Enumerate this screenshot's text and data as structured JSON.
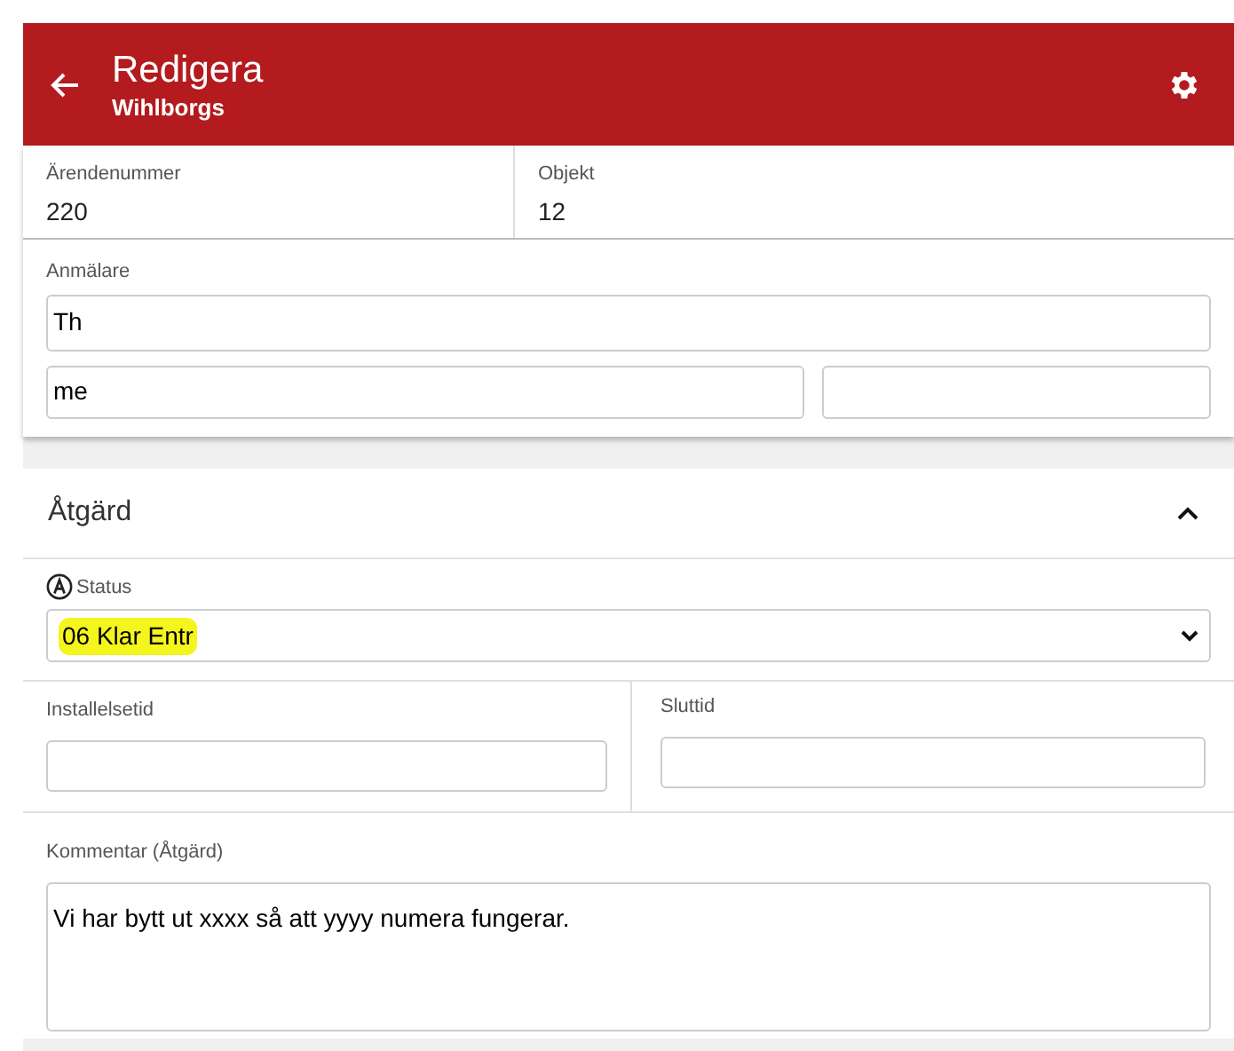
{
  "header": {
    "title": "Redigera",
    "subtitle": "Wihlborgs"
  },
  "info": [
    {
      "label": "Ärendenummer",
      "value": "220"
    },
    {
      "label": "Objekt",
      "value": "12"
    }
  ],
  "reporter": {
    "label": "Anmälare",
    "name": "Th",
    "email": "me"
  },
  "section": {
    "title": "Åtgärd",
    "expanded": true
  },
  "status": {
    "label": "Status",
    "value": "06 Klar Entr",
    "highlighted": true
  },
  "times": [
    {
      "label": "Installelsetid"
    },
    {
      "label": "Sluttid"
    }
  ],
  "comment": {
    "label": "Kommentar (Åtgärd)",
    "value": "Vi har bytt ut xxxx så att yyyy numera fungerar."
  }
}
